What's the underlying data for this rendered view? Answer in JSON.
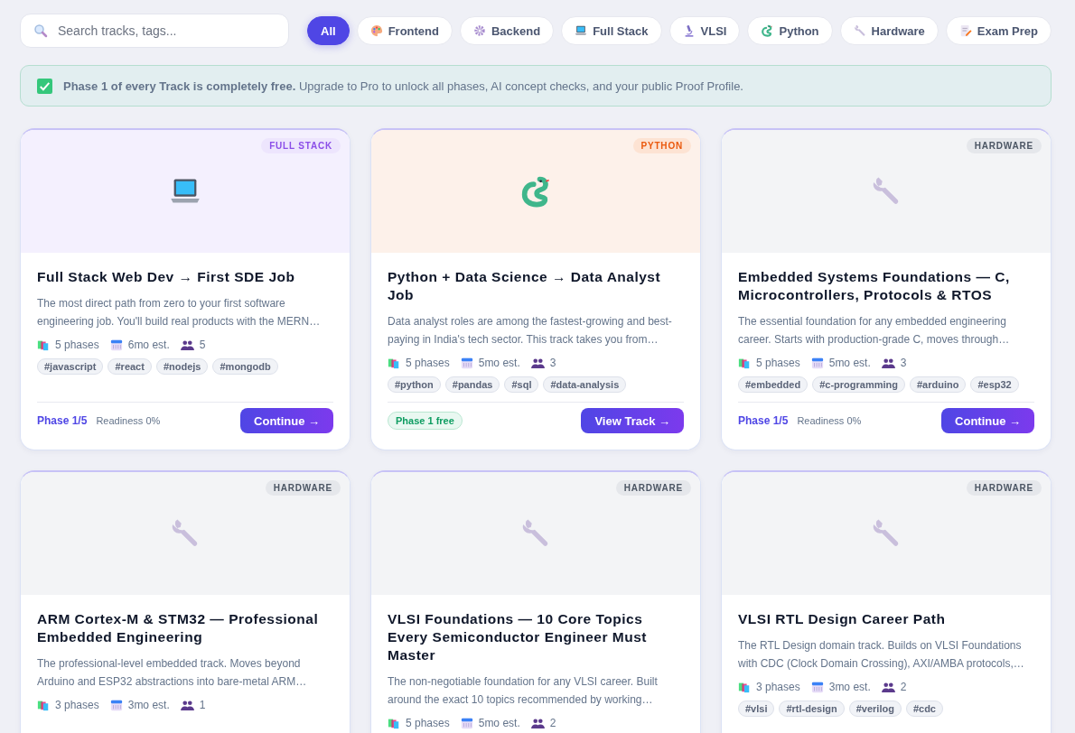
{
  "search": {
    "placeholder": "Search tracks, tags..."
  },
  "filters": [
    {
      "label": "All",
      "kind": "all",
      "selected": true
    },
    {
      "label": "Frontend",
      "kind": "frontend",
      "selected": false
    },
    {
      "label": "Backend",
      "kind": "backend",
      "selected": false
    },
    {
      "label": "Full Stack",
      "kind": "fullstack",
      "selected": false
    },
    {
      "label": "VLSI",
      "kind": "vlsi",
      "selected": false
    },
    {
      "label": "Python",
      "kind": "python",
      "selected": false
    },
    {
      "label": "Hardware",
      "kind": "hardware",
      "selected": false
    },
    {
      "label": "Exam Prep",
      "kind": "exam",
      "selected": false
    }
  ],
  "banner": {
    "text": "**Phase 1 of every Track is completely free.** Upgrade to Pro to unlock all phases, AI concept checks, and your public Proof Profile."
  },
  "cards": [
    {
      "category": "FULL STACK",
      "kind": "fullstack",
      "title": "Full Stack Web Dev → First SDE Job",
      "description": "The most direct path from zero to your first software engineering job. You'll build real products with the MERN…",
      "phases": "5 phases",
      "duration": "6mo est.",
      "learners": "5",
      "tags": [
        "#javascript",
        "#react",
        "#nodejs",
        "#mongodb"
      ],
      "footer": {
        "kind": "progress",
        "phase": "Phase 1/5",
        "readiness": "Readiness 0%",
        "action": "Continue →"
      }
    },
    {
      "category": "PYTHON",
      "kind": "python",
      "title": "Python + Data Science → Data Analyst Job",
      "description": "Data analyst roles are among the fastest-growing and best-paying in India's tech sector. This track takes you from…",
      "phases": "5 phases",
      "duration": "5mo est.",
      "learners": "3",
      "tags": [
        "#python",
        "#pandas",
        "#sql",
        "#data-analysis"
      ],
      "footer": {
        "kind": "free",
        "badge": "Phase 1 free",
        "action": "View Track →"
      }
    },
    {
      "category": "HARDWARE",
      "kind": "hardware",
      "title": "Embedded Systems Foundations — C, Microcontrollers, Protocols & RTOS",
      "description": "The essential foundation for any embedded engineering career. Starts with production-grade C, moves through…",
      "phases": "5 phases",
      "duration": "5mo est.",
      "learners": "3",
      "tags": [
        "#embedded",
        "#c-programming",
        "#arduino",
        "#esp32"
      ],
      "footer": {
        "kind": "progress",
        "phase": "Phase 1/5",
        "readiness": "Readiness 0%",
        "action": "Continue →"
      }
    },
    {
      "category": "HARDWARE",
      "kind": "hardware",
      "title": "ARM Cortex-M & STM32 — Professional Embedded Engineering",
      "description": "The professional-level embedded track. Moves beyond Arduino and ESP32 abstractions into bare-metal ARM…",
      "phases": "3 phases",
      "duration": "3mo est.",
      "learners": "1"
    },
    {
      "category": "HARDWARE",
      "kind": "hardware",
      "title": "VLSI Foundations — 10 Core Topics Every Semiconductor Engineer Must Master",
      "description": "The non-negotiable foundation for any VLSI career. Built around the exact 10 topics recommended by working…",
      "phases": "5 phases",
      "duration": "5mo est.",
      "learners": "2"
    },
    {
      "category": "HARDWARE",
      "kind": "hardware",
      "title": "VLSI RTL Design Career Path",
      "description": "The RTL Design domain track. Builds on VLSI Foundations with CDC (Clock Domain Crossing), AXI/AMBA protocols,…",
      "phases": "3 phases",
      "duration": "3mo est.",
      "learners": "2",
      "tags": [
        "#vlsi",
        "#rtl-design",
        "#verilog",
        "#cdc"
      ]
    }
  ]
}
